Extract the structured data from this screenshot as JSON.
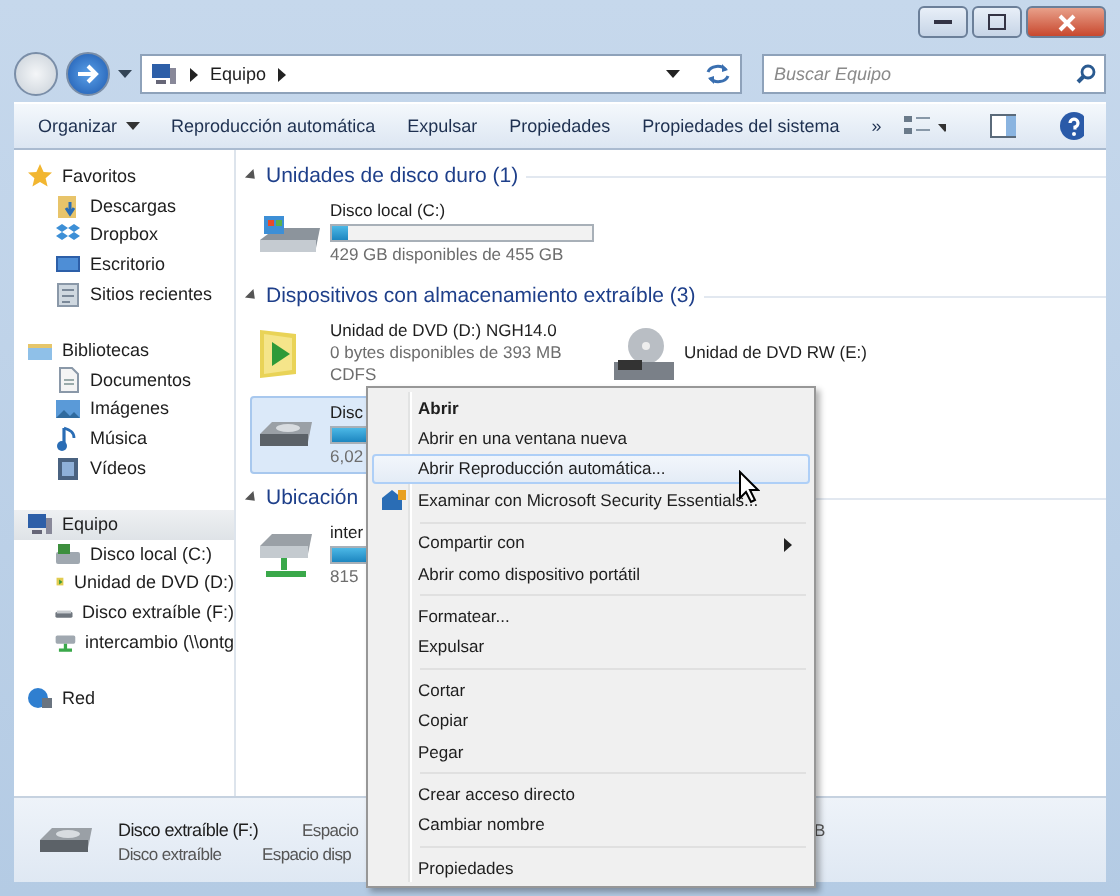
{
  "address": {
    "crumbs": [
      "Equipo"
    ]
  },
  "search": {
    "placeholder": "Buscar Equipo"
  },
  "toolbar": [
    {
      "label": "Organizar",
      "kind": "dropdown"
    },
    {
      "label": "Reproducción automática",
      "kind": "button"
    },
    {
      "label": "Expulsar",
      "kind": "button"
    },
    {
      "label": "Propiedades",
      "kind": "button"
    },
    {
      "label": "Propiedades del sistema",
      "kind": "button"
    },
    {
      "label": "»",
      "kind": "button"
    }
  ],
  "sidebar": [
    {
      "label": "Favoritos",
      "kind": "star",
      "selected": false,
      "children": [
        {
          "label": "Descargas",
          "kind": "download",
          "selected": false
        },
        {
          "label": "Dropbox",
          "kind": "dropbox",
          "selected": false
        },
        {
          "label": "Escritorio",
          "kind": "desktop",
          "selected": false
        },
        {
          "label": "Sitios recientes",
          "kind": "recent",
          "selected": false
        }
      ]
    },
    {
      "label": "Bibliotecas",
      "kind": "library",
      "selected": false,
      "children": [
        {
          "label": "Documentos",
          "kind": "document",
          "selected": false
        },
        {
          "label": "Imágenes",
          "kind": "image",
          "selected": false
        },
        {
          "label": "Música",
          "kind": "music",
          "selected": false
        },
        {
          "label": "Vídeos",
          "kind": "video",
          "selected": false
        }
      ]
    },
    {
      "label": "Equipo",
      "kind": "computer",
      "selected": true,
      "children": [
        {
          "label": "Disco local (C:)",
          "kind": "hdd",
          "selected": false
        },
        {
          "label": "Unidad de DVD (D:)",
          "kind": "dvd",
          "selected": false
        },
        {
          "label": "Disco extraíble (F:)",
          "kind": "removable",
          "selected": false
        },
        {
          "label": "intercambio (\\\\ontg",
          "kind": "network-drive",
          "selected": false
        }
      ]
    },
    {
      "label": "Red",
      "kind": "network",
      "selected": false
    }
  ],
  "sections": [
    {
      "title": "Unidades de disco duro (1)",
      "items": [
        {
          "name": "Disco local (C:)",
          "kind": "hdd",
          "selected": false,
          "level": 0.06,
          "lines": [
            "429 GB disponibles de 455 GB"
          ]
        }
      ]
    },
    {
      "title": "Dispositivos con almacenamiento extraíble (3)",
      "items": [
        {
          "name": "Unidad de DVD (D:) NGH14.0",
          "kind": "dvd",
          "selected": false,
          "lines": [
            "0 bytes disponibles de 393 MB",
            "CDFS"
          ]
        },
        {
          "name": "Unidad de DVD RW (E:)",
          "kind": "dvd-rw",
          "selected": false
        },
        {
          "name": "Disc",
          "kind": "removable",
          "selected": true,
          "level": 0.3,
          "lines": [
            "6,02"
          ]
        }
      ]
    },
    {
      "title": "Ubicación",
      "items": [
        {
          "name": "inter",
          "kind": "network-drive",
          "selected": false,
          "level": 0.4,
          "lines": [
            "815"
          ]
        }
      ]
    }
  ],
  "context_menu": [
    {
      "label": "Abrir",
      "kind": "default",
      "selected": false
    },
    {
      "label": "Abrir en una ventana nueva",
      "kind": "item",
      "selected": false
    },
    {
      "label": "Abrir Reproducción automática...",
      "kind": "item",
      "selected": true
    },
    {
      "label": "Examinar con Microsoft Security Essentials...",
      "kind": "shield",
      "selected": false
    },
    {
      "kind": "separator"
    },
    {
      "label": "Compartir con",
      "kind": "submenu",
      "selected": false
    },
    {
      "label": "Abrir como dispositivo portátil",
      "kind": "item",
      "selected": false
    },
    {
      "kind": "separator"
    },
    {
      "label": "Formatear...",
      "kind": "item",
      "selected": false
    },
    {
      "label": "Expulsar",
      "kind": "item",
      "selected": false
    },
    {
      "kind": "separator"
    },
    {
      "label": "Cortar",
      "kind": "item",
      "selected": false
    },
    {
      "label": "Copiar",
      "kind": "item",
      "selected": false
    },
    {
      "label": "Pegar",
      "kind": "item",
      "selected": false
    },
    {
      "kind": "separator"
    },
    {
      "label": "Crear acceso directo",
      "kind": "item",
      "selected": false
    },
    {
      "label": "Cambiar nombre",
      "kind": "item",
      "selected": false
    },
    {
      "kind": "separator"
    },
    {
      "label": "Propiedades",
      "kind": "item",
      "selected": false
    }
  ],
  "details": {
    "name": "Disco extraíble (F:)",
    "type": "Disco extraíble",
    "space_label": "Espacio",
    "space_label_2": "Espacio disp",
    "column_3": "B"
  }
}
